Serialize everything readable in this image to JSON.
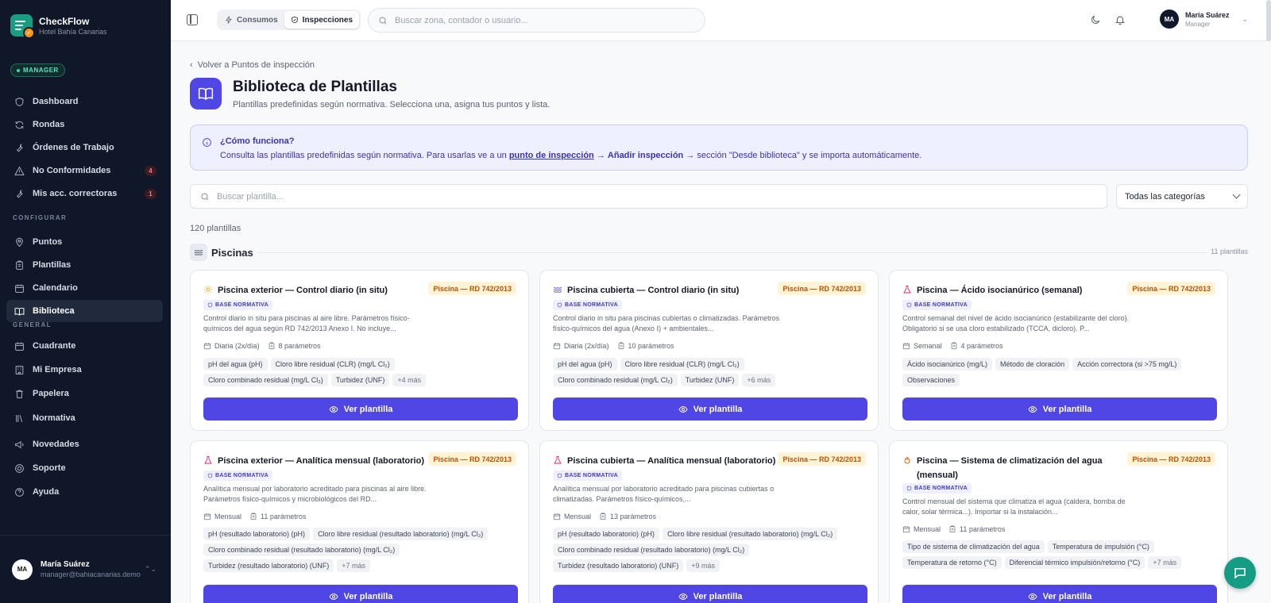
{
  "brand": {
    "name": "CheckFlow",
    "subtitle": "Hotel Bahía Canarias"
  },
  "role_badge": "MANAGER",
  "nav_main": [
    {
      "label": "Dashboard",
      "icon": "shield-icon"
    },
    {
      "label": "Rondas",
      "icon": "refresh-icon"
    },
    {
      "label": "Órdenes de Trabajo",
      "icon": "wrench-icon"
    },
    {
      "label": "No Conformidades",
      "icon": "alert-triangle-icon",
      "badge": "4"
    },
    {
      "label": "Mis acc. correctoras",
      "icon": "wrench-icon",
      "badge": "1"
    }
  ],
  "section_configurar": "CONFIGURAR",
  "nav_config": [
    {
      "label": "Puntos",
      "icon": "map-pin-icon"
    },
    {
      "label": "Plantillas",
      "icon": "clipboard-icon"
    },
    {
      "label": "Calendario",
      "icon": "calendar-icon"
    },
    {
      "label": "Biblioteca",
      "icon": "book-icon",
      "active": true
    }
  ],
  "section_general": "GENERAL",
  "nav_general": [
    {
      "label": "Cuadrante",
      "icon": "calendar-icon"
    },
    {
      "label": "Mi Empresa",
      "icon": "building-icon"
    },
    {
      "label": "Papelera",
      "icon": "trash-icon"
    },
    {
      "label": "Normativa",
      "icon": "library-icon"
    }
  ],
  "nav_extra": [
    {
      "label": "Novedades",
      "icon": "megaphone-icon"
    },
    {
      "label": "Soporte",
      "icon": "lifebuoy-icon"
    },
    {
      "label": "Ayuda",
      "icon": "help-circle-icon"
    }
  ],
  "user": {
    "initials": "MA",
    "name": "María Suárez",
    "email": "manager@bahiacanarias.demo",
    "role": "Manager"
  },
  "topbar": {
    "tab_consumos": "Consumos",
    "tab_inspecciones": "Inspecciones",
    "search_placeholder": "Buscar zona, contador o usuario..."
  },
  "page": {
    "back": "Volver a Puntos de inspección",
    "title": "Biblioteca de Plantillas",
    "subtitle": "Plantillas predefinidas según normativa. Selecciona una, asigna tus puntos y lista."
  },
  "info": {
    "title": "¿Cómo funciona?",
    "text_1": "Consulta las plantillas predefinidas según normativa. Para usarlas ve a un",
    "link_1": "punto de inspección",
    "arrow_1": "→",
    "link_2": "Añadir inspección",
    "text_2": "→ sección \"Desde biblioteca\" y se importa automáticamente."
  },
  "library_search_placeholder": "Buscar plantilla...",
  "category_select": "Todas las categorías",
  "count": "120 plantillas",
  "section": {
    "name": "Piscinas",
    "count": "11 plantillas"
  },
  "base_label": "BASE NORMATIVA",
  "cards": [
    {
      "title": "Piscina exterior — Control diario (in situ)",
      "icon": "sun-icon",
      "tag": "Piscina — RD 742/2013",
      "desc": "Control diario in situ para piscinas al aire libre. Parámetros físico-químicos del agua según RD 742/2013 Anexo I. No incluye...",
      "freq": "Diaria (2x/día)",
      "params": "8 parámetros",
      "chips": [
        "pH del agua (pH)",
        "Cloro libre residual (CLR) (mg/L Cl₂)",
        "Cloro combinado residual (mg/L Cl₂)",
        "Turbidez (UNF)"
      ],
      "more": "+4 más",
      "button": "Ver plantilla"
    },
    {
      "title": "Piscina cubierta — Control diario (in situ)",
      "icon": "waves-icon",
      "tag": "Piscina — RD 742/2013",
      "desc": "Control diario in situ para piscinas cubiertas o climatizadas. Parámetros físico-químicos del agua (Anexo I) + ambientales...",
      "freq": "Diaria (2x/día)",
      "params": "10 parámetros",
      "chips": [
        "pH del agua (pH)",
        "Cloro libre residual (CLR) (mg/L Cl₂)",
        "Cloro combinado residual (mg/L Cl₂)",
        "Turbidez (UNF)"
      ],
      "more": "+6 más",
      "button": "Ver plantilla"
    },
    {
      "title": "Piscina — Ácido isocianúrico (semanal)",
      "icon": "flask-icon",
      "tag": "Piscina — RD 742/2013",
      "desc": "Control semanal del nivel de ácido isocianúrico (estabilizante del cloro). Obligatorio si se usa cloro estabilizado (TCCA, dicloro). P...",
      "freq": "Semanal",
      "params": "4 parámetros",
      "chips": [
        "Ácido isocianúrico (mg/L)",
        "Método de cloración",
        "Acción correctora (si >75 mg/L)",
        "Observaciones"
      ],
      "more": "",
      "button": "Ver plantilla"
    },
    {
      "title": "Piscina exterior — Analítica mensual (laboratorio)",
      "icon": "flask-icon",
      "tag": "Piscina — RD 742/2013",
      "desc": "Analítica mensual por laboratorio acreditado para piscinas al aire libre. Parámetros físico-químicos y microbiológicos del RD...",
      "freq": "Mensual",
      "params": "11 parámetros",
      "chips": [
        "pH (resultado laboratorio) (pH)",
        "Cloro libre residual (resultado laboratorio) (mg/L Cl₂)",
        "Cloro combinado residual (resultado laboratorio) (mg/L Cl₂)",
        "Turbidez (resultado laboratorio) (UNF)"
      ],
      "more": "+7 más",
      "button": "Ver plantilla"
    },
    {
      "title": "Piscina cubierta — Analítica mensual (laboratorio)",
      "icon": "flask-icon",
      "tag": "Piscina — RD 742/2013",
      "desc": "Analítica mensual por laboratorio acreditado para piscinas cubiertas o climatizadas. Parámetros físico-químicos,...",
      "freq": "Mensual",
      "params": "13 parámetros",
      "chips": [
        "pH (resultado laboratorio) (pH)",
        "Cloro libre residual (resultado laboratorio) (mg/L Cl₂)",
        "Cloro combinado residual (resultado laboratorio) (mg/L Cl₂)",
        "Turbidez (resultado laboratorio) (UNF)"
      ],
      "more": "+9 más",
      "button": "Ver plantilla"
    },
    {
      "title": "Piscina — Sistema de climatización del agua (mensual)",
      "icon": "flame-icon",
      "tag": "Piscina — RD 742/2013",
      "desc": "Control mensual del sistema que climatiza el agua (caldera, bomba de calor, solar térmica...). Importar si la instalación...",
      "freq": "Mensual",
      "params": "11 parámetros",
      "chips": [
        "Tipo de sistema de climatización del agua",
        "Temperatura de impulsión (°C)",
        "Temperatura de retorno (°C)",
        "Diferencial térmico impulsión/retorno (°C)"
      ],
      "more": "+7 más",
      "button": "Ver plantilla"
    }
  ],
  "colors": {
    "accent": "#4f46e5",
    "sidebar": "#0f1729",
    "brand": "#199c82",
    "tag_bg": "#fff3d6",
    "tag_text": "#b45309"
  }
}
